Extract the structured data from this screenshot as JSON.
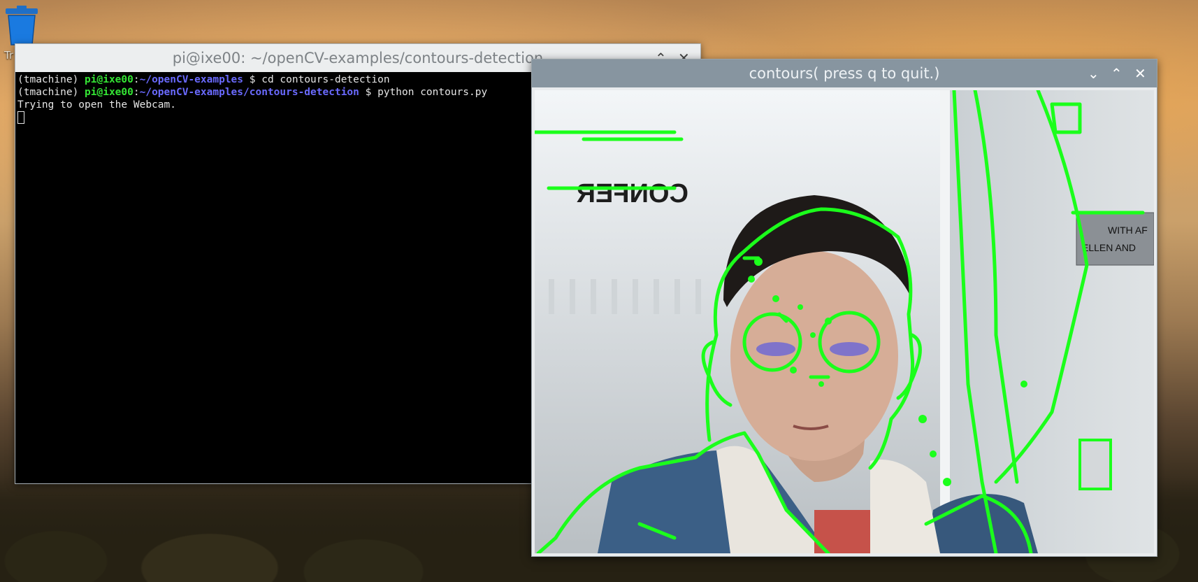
{
  "desktop": {
    "trash_label": "Tr"
  },
  "terminal": {
    "title": "pi@ixe00: ~/openCV-examples/contours-detection",
    "controls": {
      "minimize": "⌄",
      "maximize": "⌃",
      "close": "✕"
    },
    "lines": [
      {
        "env": "(tmachine) ",
        "user": "pi@ixe00",
        "sep": ":",
        "path": "~/openCV-examples",
        "dollar": " $ ",
        "cmd": "cd contours-detection"
      },
      {
        "env": "(tmachine) ",
        "user": "pi@ixe00",
        "sep": ":",
        "path": "~/openCV-examples/contours-detection",
        "dollar": " $ ",
        "cmd": "python contours.py"
      }
    ],
    "output": "Trying to open the Webcam."
  },
  "contours_window": {
    "title": "contours( press q to quit.)",
    "controls": {
      "minimize": "⌄",
      "maximize": "⌃",
      "close": "✕"
    },
    "sign_text": [
      "WITH AF",
      "ELLEN AND"
    ],
    "poster_text": "CONFER"
  },
  "colors": {
    "contour": "#1bff1b",
    "terminal_bg": "#000000",
    "prompt_user": "#34e534",
    "prompt_path": "#6a6aff"
  }
}
